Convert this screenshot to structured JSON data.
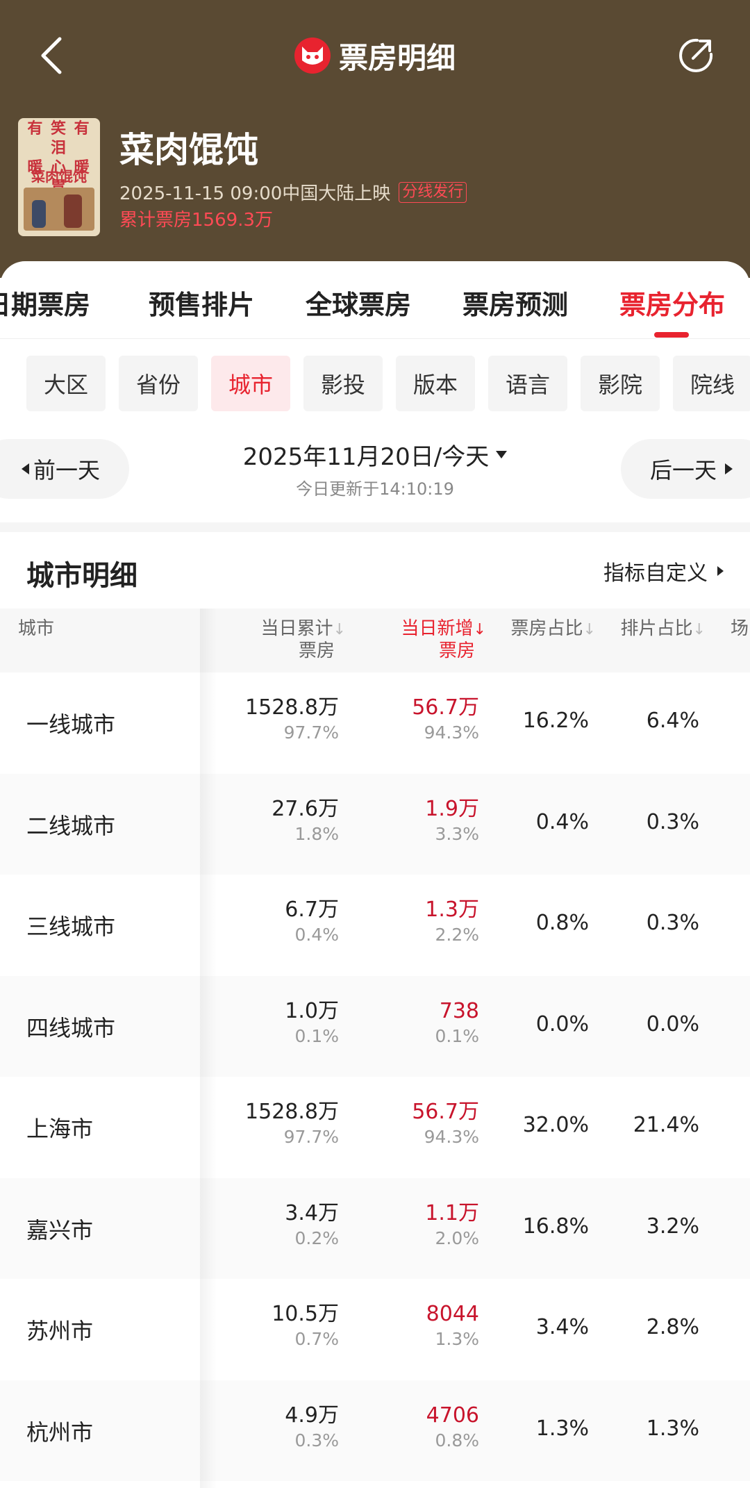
{
  "header": {
    "title": "票房明细",
    "movie_title": "菜肉馄饨",
    "release": "2025-11-15 09:00中国大陆上映",
    "badge": "分线发行",
    "cumulative": "累计票房1569.3万",
    "poster_lines": [
      "有 笑 有 泪",
      "暖 心 暖 胃"
    ],
    "poster_title": "菜肉馄饨"
  },
  "tabs": [
    "日期票房",
    "预售排片",
    "全球票房",
    "票房预测",
    "票房分布"
  ],
  "active_tab": "票房分布",
  "chips": [
    "大区",
    "省份",
    "城市",
    "影投",
    "版本",
    "语言",
    "影院",
    "院线"
  ],
  "active_chip": "城市",
  "date_nav": {
    "prev": "前一天",
    "next": "后一天",
    "date": "2025年11月20日/今天",
    "updated": "今日更新于14:10:19"
  },
  "section": {
    "title": "城市明细",
    "custom": "指标自定义"
  },
  "table": {
    "headers": {
      "city": "城市",
      "cum_line1": "当日累计",
      "cum_line2": "票房",
      "new_line1": "当日新增",
      "new_line2": "票房",
      "box_share": "票房占比",
      "show_share": "排片占比",
      "more": "场"
    },
    "sort_icon": "↓",
    "rows": [
      {
        "city": "一线城市",
        "cum": "1528.8万",
        "cum_pct": "97.7%",
        "new": "56.7万",
        "new_pct": "94.3%",
        "box_share": "16.2%",
        "show_share": "6.4%"
      },
      {
        "city": "二线城市",
        "cum": "27.6万",
        "cum_pct": "1.8%",
        "new": "1.9万",
        "new_pct": "3.3%",
        "box_share": "0.4%",
        "show_share": "0.3%"
      },
      {
        "city": "三线城市",
        "cum": "6.7万",
        "cum_pct": "0.4%",
        "new": "1.3万",
        "new_pct": "2.2%",
        "box_share": "0.8%",
        "show_share": "0.3%"
      },
      {
        "city": "四线城市",
        "cum": "1.0万",
        "cum_pct": "0.1%",
        "new": "738",
        "new_pct": "0.1%",
        "box_share": "0.0%",
        "show_share": "0.0%"
      },
      {
        "city": "上海市",
        "cum": "1528.8万",
        "cum_pct": "97.7%",
        "new": "56.7万",
        "new_pct": "94.3%",
        "box_share": "32.0%",
        "show_share": "21.4%"
      },
      {
        "city": "嘉兴市",
        "cum": "3.4万",
        "cum_pct": "0.2%",
        "new": "1.1万",
        "new_pct": "2.0%",
        "box_share": "16.8%",
        "show_share": "3.2%"
      },
      {
        "city": "苏州市",
        "cum": "10.5万",
        "cum_pct": "0.7%",
        "new": "8044",
        "new_pct": "1.3%",
        "box_share": "3.4%",
        "show_share": "2.8%"
      },
      {
        "city": "杭州市",
        "cum": "4.9万",
        "cum_pct": "0.3%",
        "new": "4706",
        "new_pct": "0.8%",
        "box_share": "1.3%",
        "show_share": "1.3%"
      }
    ]
  },
  "colors": {
    "header_bg": "#5a4a33",
    "accent": "#e8232f",
    "chip_active_bg": "#fde9eb"
  },
  "icons": {
    "back": "chevron-left-icon",
    "logo": "cat-logo-icon",
    "share": "share-icon"
  }
}
